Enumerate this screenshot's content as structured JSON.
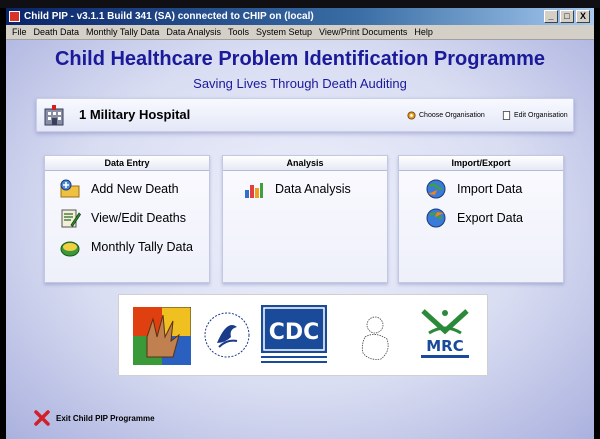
{
  "window": {
    "title": "Child PIP - v3.1.1 Build 341 (SA) connected to CHIP on (local)",
    "controls": {
      "minimize": "_",
      "maximize": "□",
      "close": "X"
    }
  },
  "menu": [
    "File",
    "Death Data",
    "Monthly Tally Data",
    "Data Analysis",
    "Tools",
    "System Setup",
    "View/Print Documents",
    "Help"
  ],
  "header": {
    "title": "Child Healthcare Problem Identification Programme",
    "subtitle": "Saving Lives Through Death Auditing"
  },
  "organisation": {
    "name": "1 Military Hospital",
    "choose_label": "Choose Organisation",
    "edit_label": "Edit Organisation"
  },
  "panels": {
    "data_entry": {
      "title": "Data Entry",
      "items": [
        {
          "label": "Add New Death",
          "icon": "folder-add-icon"
        },
        {
          "label": "View/Edit Deaths",
          "icon": "edit-document-icon"
        },
        {
          "label": "Monthly Tally Data",
          "icon": "tally-icon"
        }
      ]
    },
    "analysis": {
      "title": "Analysis",
      "items": [
        {
          "label": "Data Analysis",
          "icon": "bar-chart-icon"
        }
      ]
    },
    "import_export": {
      "title": "Import/Export",
      "items": [
        {
          "label": "Import Data",
          "icon": "import-globe-icon"
        },
        {
          "label": "Export Data",
          "icon": "export-globe-icon"
        }
      ]
    }
  },
  "logos": {
    "cdc": "CDC",
    "mrc": "MRC"
  },
  "footer": {
    "exit_label": "Exit Child PIP Programme"
  },
  "colors": {
    "title_blue": "#1a1a9a",
    "background": "#d9ddf2",
    "exit_red": "#d0202a"
  }
}
